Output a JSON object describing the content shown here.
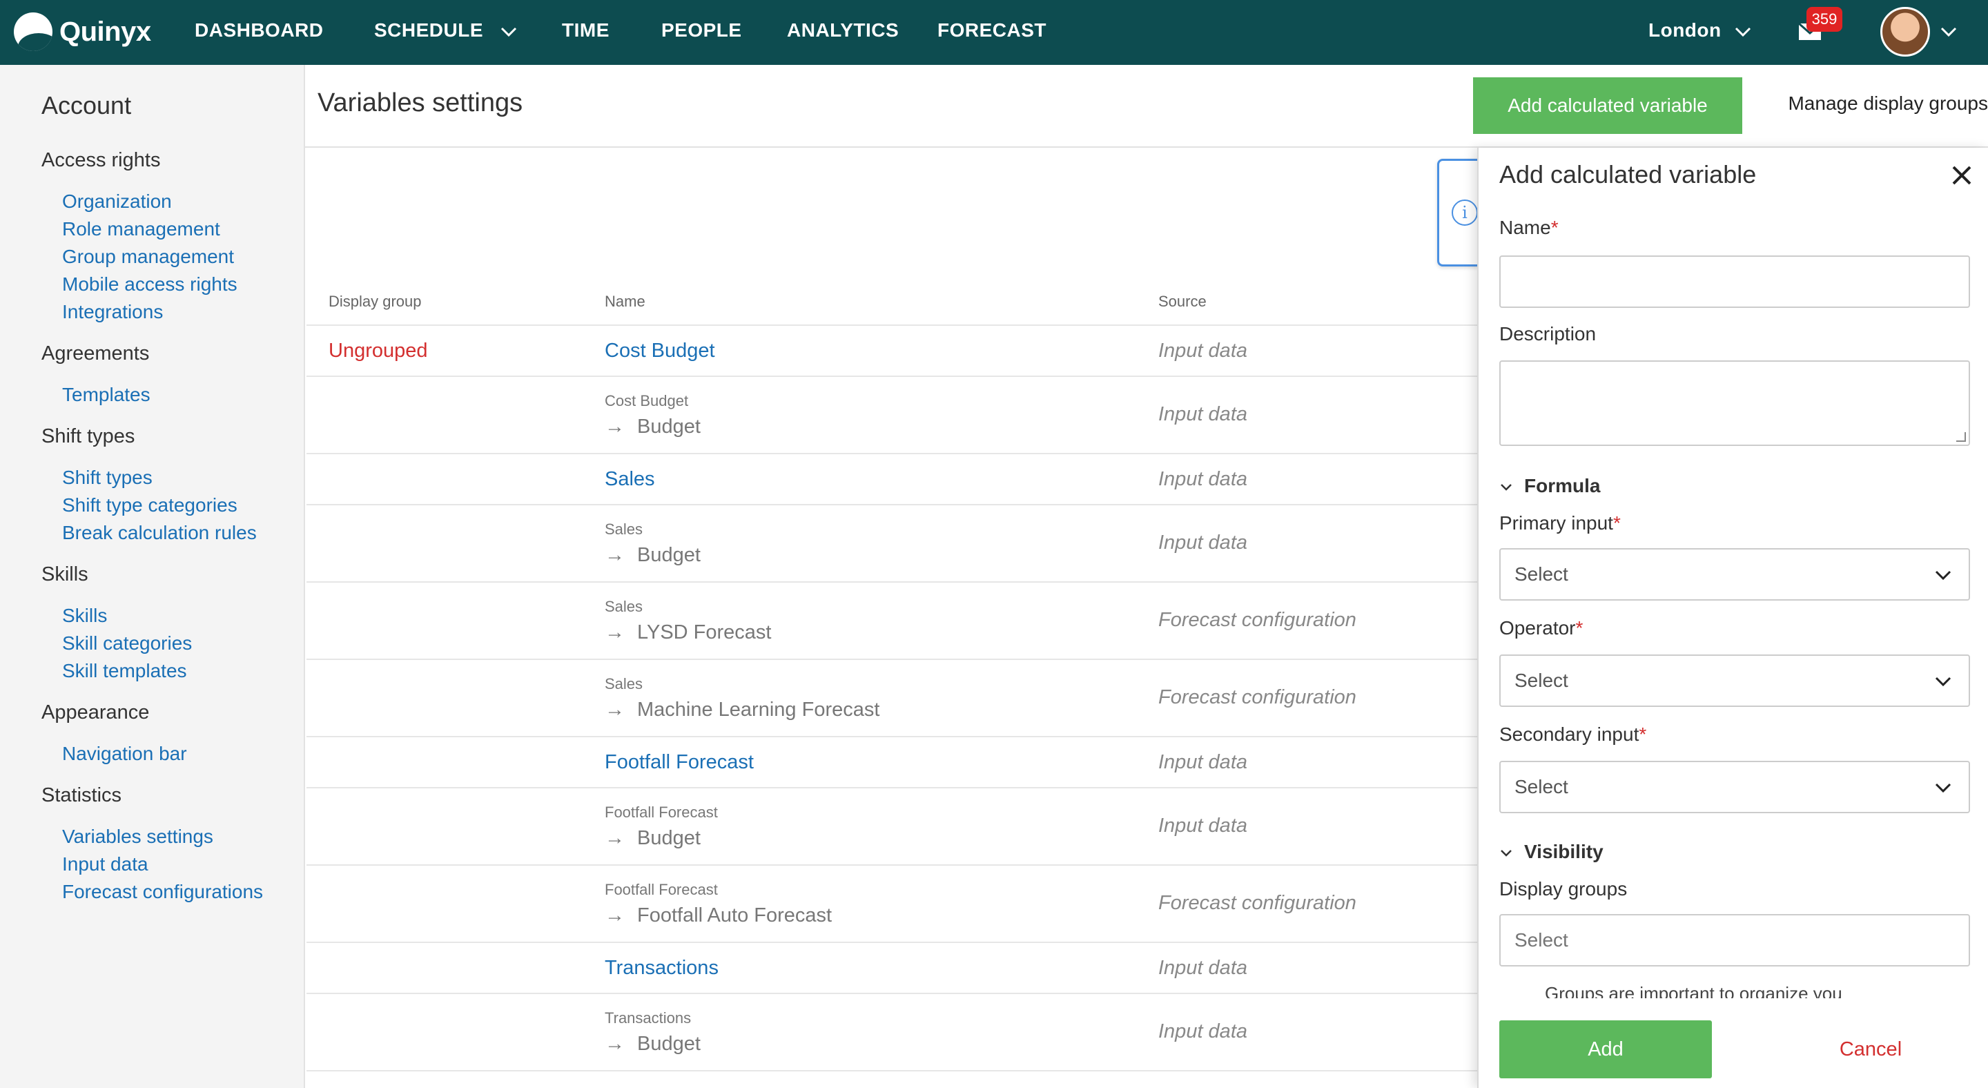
{
  "brand": "Quinyx",
  "nav": {
    "dashboard": "DASHBOARD",
    "schedule": "SCHEDULE",
    "time": "TIME",
    "people": "PEOPLE",
    "analytics": "ANALYTICS",
    "forecast": "FORECAST",
    "location": "London",
    "notifications": "359"
  },
  "sidebar": {
    "title": "Account",
    "sections": [
      {
        "heading": "Access rights",
        "links": [
          "Organization",
          "Role management",
          "Group management",
          "Mobile access rights",
          "Integrations"
        ]
      },
      {
        "heading": "Agreements",
        "links": [
          "Templates"
        ]
      },
      {
        "heading": "Shift types",
        "links": [
          "Shift types",
          "Shift type categories",
          "Break calculation rules"
        ]
      },
      {
        "heading": "Skills",
        "links": [
          "Skills",
          "Skill categories",
          "Skill templates"
        ]
      },
      {
        "heading": "Appearance",
        "links": [
          "Navigation bar"
        ]
      },
      {
        "heading": "Statistics",
        "links": [
          "Variables settings",
          "Input data",
          "Forecast configurations"
        ]
      }
    ]
  },
  "header": {
    "title": "Variables settings",
    "add_button": "Add calculated variable",
    "manage_button": "Manage display groups"
  },
  "table": {
    "columns": {
      "group": "Display group",
      "name": "Name",
      "source": "Source"
    },
    "rows": [
      {
        "group": "Ungrouped",
        "name": "Cost Budget",
        "source": "Input data"
      },
      {
        "parent": "Cost Budget",
        "child": "Budget",
        "source": "Input data"
      },
      {
        "name": "Sales",
        "source": "Input data"
      },
      {
        "parent": "Sales",
        "child": "Budget",
        "source": "Input data"
      },
      {
        "parent": "Sales",
        "child": "LYSD Forecast",
        "source": "Forecast configuration"
      },
      {
        "parent": "Sales",
        "child": "Machine Learning Forecast",
        "source": "Forecast configuration"
      },
      {
        "name": "Footfall Forecast",
        "source": "Input data"
      },
      {
        "parent": "Footfall Forecast",
        "child": "Budget",
        "source": "Input data"
      },
      {
        "parent": "Footfall Forecast",
        "child": "Footfall Auto Forecast",
        "source": "Forecast configuration"
      },
      {
        "name": "Transactions",
        "source": "Input data"
      },
      {
        "parent": "Transactions",
        "child": "Budget",
        "source": "Input data"
      }
    ]
  },
  "panel": {
    "title": "Add calculated variable",
    "name_label": "Name",
    "name_value": "",
    "description_label": "Description",
    "formula_section": "Formula",
    "primary_label": "Primary input",
    "primary_value": "Select",
    "operator_label": "Operator",
    "operator_value": "Select",
    "secondary_label": "Secondary input",
    "secondary_value": "Select",
    "visibility_section": "Visibility",
    "display_groups_label": "Display groups",
    "display_groups_placeholder": "Select",
    "hint": "Groups are important to organize you",
    "add_button": "Add",
    "cancel_button": "Cancel",
    "required_mark": "*"
  },
  "colors": {
    "topbar": "#0d4c50",
    "accent_green": "#5cb85c",
    "link_blue": "#1a6fb5",
    "danger_red": "#d32f2f"
  }
}
